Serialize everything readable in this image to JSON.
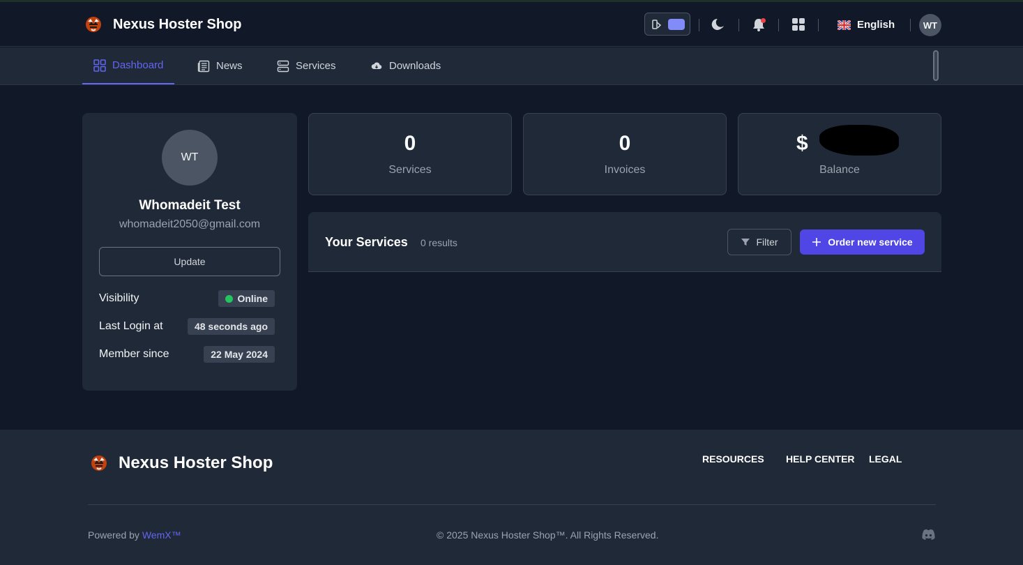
{
  "header": {
    "brand": "Nexus Hoster Shop",
    "language": "English",
    "avatar_initials": "WT"
  },
  "nav": {
    "items": [
      {
        "label": "Dashboard",
        "icon": "dashboard-grid-icon",
        "active": true
      },
      {
        "label": "News",
        "icon": "newspaper-icon",
        "active": false
      },
      {
        "label": "Services",
        "icon": "server-icon",
        "active": false
      },
      {
        "label": "Downloads",
        "icon": "cloud-download-icon",
        "active": false
      }
    ]
  },
  "profile": {
    "initials": "WT",
    "name": "Whomadeit Test",
    "email": "whomadeit2050@gmail.com",
    "update_label": "Update",
    "rows": [
      {
        "label": "Visibility",
        "value": "Online"
      },
      {
        "label": "Last Login at",
        "value": "48 seconds ago"
      },
      {
        "label": "Member since",
        "value": "22 May 2024"
      }
    ]
  },
  "stats": [
    {
      "value": "0",
      "label": "Services"
    },
    {
      "value": "0",
      "label": "Invoices"
    },
    {
      "value": "$",
      "label": "Balance"
    }
  ],
  "services": {
    "title": "Your Services",
    "count": "0 results",
    "filter_label": "Filter",
    "order_label": "Order new service"
  },
  "footer": {
    "brand": "Nexus Hoster Shop",
    "links": [
      "RESOURCES",
      "HELP CENTER",
      "LEGAL"
    ],
    "powered_prefix": "Powered by ",
    "powered_link": "WemX™",
    "copyright": "© 2025 Nexus Hoster Shop™. All Rights Reserved."
  },
  "colors": {
    "accent": "#6366f1",
    "primary_button": "#4f46e5",
    "background": "#111827",
    "card": "#1f2937",
    "online": "#22c55e",
    "notification": "#ef4444"
  }
}
